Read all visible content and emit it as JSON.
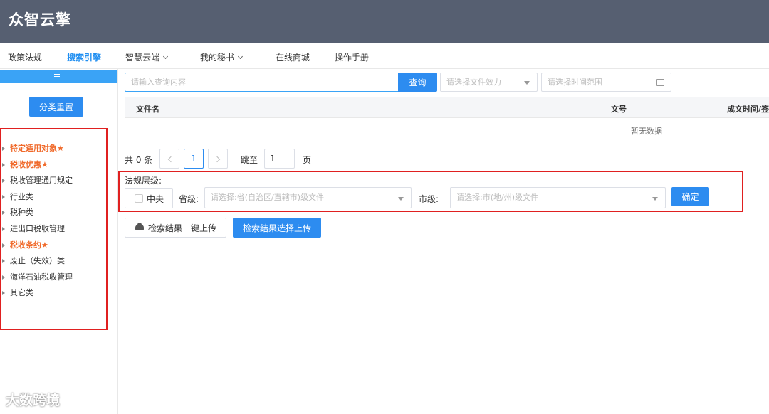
{
  "header": {
    "logo": "众智云擎"
  },
  "nav": [
    {
      "label": "政策法规",
      "active": false
    },
    {
      "label": "搜索引擎",
      "active": true
    },
    {
      "label": "智慧云端",
      "dropdown": true
    },
    {
      "label": "我的秘书",
      "dropdown": true
    },
    {
      "label": "在线商城"
    },
    {
      "label": "操作手册"
    }
  ],
  "sidebar": {
    "reset_label": "分类重置",
    "items": [
      {
        "label": "特定适用对象★",
        "highlight": true
      },
      {
        "label": "税收优惠★",
        "highlight": true
      },
      {
        "label": "税收管理通用规定"
      },
      {
        "label": "行业类"
      },
      {
        "label": "税种类"
      },
      {
        "label": "进出口税收管理"
      },
      {
        "label": "税收条约★",
        "highlight": true
      },
      {
        "label": "废止（失效）类"
      },
      {
        "label": "海洋石油税收管理"
      },
      {
        "label": "其它类"
      }
    ]
  },
  "search": {
    "placeholder": "请输入查询内容",
    "button": "查询",
    "effect_placeholder": "请选择文件效力",
    "time_placeholder": "请选择时间范围"
  },
  "table": {
    "columns": [
      "文件名",
      "文号",
      "成文时间/签订"
    ],
    "empty_text": "暂无数据"
  },
  "pagination": {
    "total": "共 0 条",
    "current_page": "1",
    "jump_label": "跳至",
    "jump_value": "1",
    "page_unit": "页"
  },
  "level_filter": {
    "title": "法规层级:",
    "central_label": "中央",
    "province_label": "省级:",
    "province_placeholder": "请选择:省(自治区/直辖市)级文件",
    "city_label": "市级:",
    "city_placeholder": "请选择:市(地/州)级文件",
    "confirm": "确定"
  },
  "upload": {
    "one_click": "检索结果一键上传",
    "select_upload": "检索结果选择上传"
  },
  "watermark": "大数跨境",
  "colors": {
    "primary": "#2d8cf0",
    "header_bg": "#565f71",
    "highlight": "#f06a2b",
    "annotation": "#e02020"
  }
}
